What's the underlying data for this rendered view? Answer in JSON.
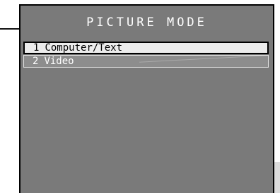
{
  "osd": {
    "title": "PICTURE MODE",
    "items": [
      {
        "number": "1",
        "label": "Computer/Text",
        "selected": true
      },
      {
        "number": "2",
        "label": "Video",
        "selected": false
      }
    ]
  },
  "colors": {
    "panel_background": "#7a7a7a",
    "panel_border": "#000000",
    "title_text": "#ffffff",
    "selected_item_background": "#ececec",
    "selected_item_text": "#000000",
    "unselected_item_background": "#8d8d8d",
    "unselected_item_text": "#ffffff"
  }
}
